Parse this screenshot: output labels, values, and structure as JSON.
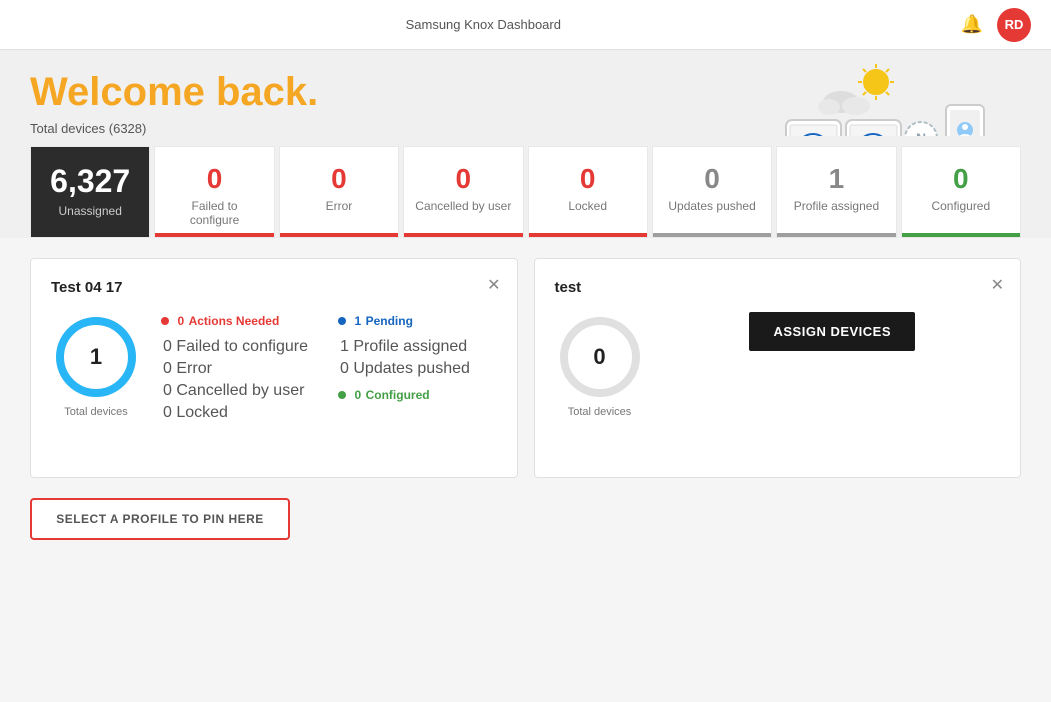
{
  "header": {
    "title": "Samsung Knox Dashboard",
    "user_initials": "RD"
  },
  "welcome": {
    "greeting": "Welcome back",
    "punctuation": ".",
    "total_label": "Total devices (6328)"
  },
  "stats": [
    {
      "id": "unassigned",
      "number": "6,327",
      "label": "Unassigned",
      "color": "dark",
      "bar": "none"
    },
    {
      "id": "failed",
      "number": "0",
      "label": "Failed to configure",
      "color": "red",
      "bar": "red"
    },
    {
      "id": "error",
      "number": "0",
      "label": "Error",
      "color": "red",
      "bar": "red"
    },
    {
      "id": "cancelled",
      "number": "0",
      "label": "Cancelled by user",
      "color": "red",
      "bar": "red"
    },
    {
      "id": "locked",
      "number": "0",
      "label": "Locked",
      "color": "red",
      "bar": "red"
    },
    {
      "id": "updates",
      "number": "0",
      "label": "Updates pushed",
      "color": "gray",
      "bar": "gray"
    },
    {
      "id": "profile",
      "number": "1",
      "label": "Profile assigned",
      "color": "gray",
      "bar": "gray"
    },
    {
      "id": "configured",
      "number": "0",
      "label": "Configured",
      "color": "green",
      "bar": "green"
    }
  ],
  "profile_card1": {
    "title": "Test 04 17",
    "total_devices": "1",
    "total_label": "Total devices",
    "actions_needed_count": "0",
    "actions_needed_label": "Actions Needed",
    "failed_count": "0",
    "failed_label": "Failed to configure",
    "error_count": "0",
    "error_label": "Error",
    "cancelled_count": "0",
    "cancelled_label": "Cancelled by user",
    "locked_count": "0",
    "locked_label": "Locked",
    "pending_count": "1",
    "pending_label": "Pending",
    "profile_assigned_count": "1",
    "profile_assigned_label": "Profile assigned",
    "updates_pushed_count": "0",
    "updates_pushed_label": "Updates pushed",
    "configured_count": "0",
    "configured_label": "Configured"
  },
  "profile_card2": {
    "title": "test",
    "total_devices": "0",
    "total_label": "Total devices",
    "assign_btn_label": "ASSIGN DEVICES"
  },
  "pin_section": {
    "button_label": "SELECT A PROFILE TO PIN HERE"
  }
}
